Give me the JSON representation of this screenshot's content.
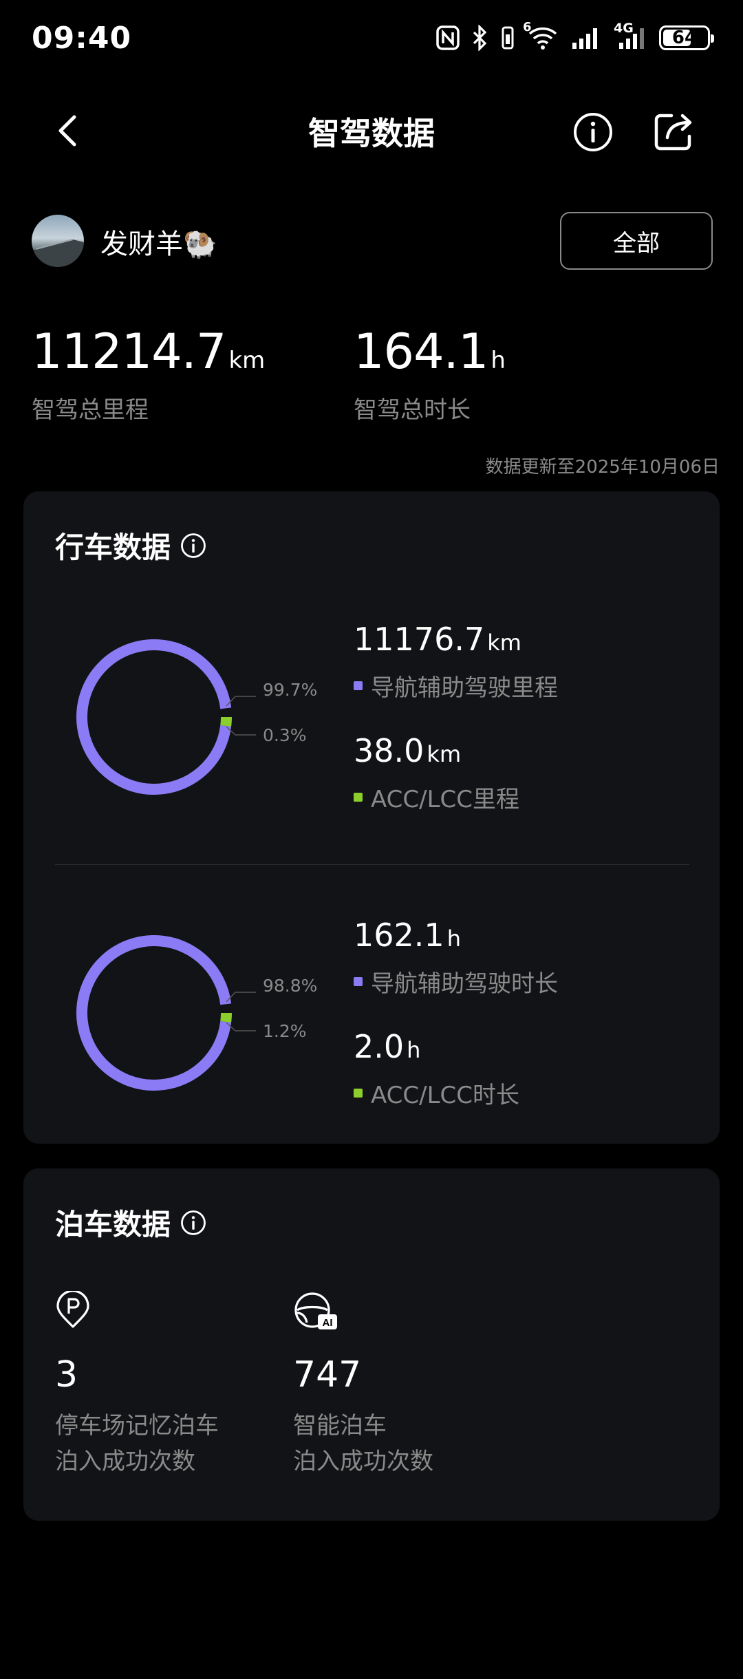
{
  "status_bar": {
    "time": "09:40",
    "battery": "64",
    "battery_level": 0.64,
    "network_label": "4G",
    "wifi_badge": "6",
    "icons": [
      "nfc-icon",
      "bluetooth-icon",
      "wifi-icon",
      "signal-icon",
      "battery-icon"
    ]
  },
  "header": {
    "title": "智驾数据",
    "icons": [
      "back-icon",
      "info-icon",
      "share-icon"
    ]
  },
  "user": {
    "name": "发财羊🐏",
    "filter_label": "全部"
  },
  "totals": {
    "mileage_value": "11214.7",
    "mileage_unit": "km",
    "mileage_label": "智驾总里程",
    "duration_value": "164.1",
    "duration_unit": "h",
    "duration_label": "智驾总时长",
    "update_note": "数据更新至2025年10月06日"
  },
  "driving": {
    "title": "行车数据",
    "mileage": {
      "nav_value": "11176.7",
      "nav_unit": "km",
      "nav_label": "导航辅助驾驶里程",
      "acc_value": "38.0",
      "acc_unit": "km",
      "acc_label": "ACC/LCC里程",
      "nav_pct": "99.7%",
      "acc_pct": "0.3%"
    },
    "duration": {
      "nav_value": "162.1",
      "nav_unit": "h",
      "nav_label": "导航辅助驾驶时长",
      "acc_value": "2.0",
      "acc_unit": "h",
      "acc_label": "ACC/LCC时长",
      "nav_pct": "98.8%",
      "acc_pct": "1.2%"
    }
  },
  "parking": {
    "title": "泊车数据",
    "memory_value": "3",
    "memory_label_1": "停车场记忆泊车",
    "memory_label_2": "泊入成功次数",
    "smart_value": "747",
    "smart_label_1": "智能泊车",
    "smart_label_2": "泊入成功次数",
    "icons": [
      "parking-pin-icon",
      "ai-steering-icon"
    ]
  },
  "colors": {
    "nav": "#8b7cf6",
    "acc": "#8ccf2c",
    "background": "#000000",
    "card": "#121316",
    "muted_text": "#8a8a8a"
  },
  "chart_data": [
    {
      "type": "pie",
      "categories": [
        "导航辅助驾驶里程",
        "ACC/LCC里程"
      ],
      "values": [
        99.7,
        0.3
      ],
      "labels": [
        "99.7%",
        "0.3%"
      ]
    },
    {
      "type": "pie",
      "categories": [
        "导航辅助驾驶时长",
        "ACC/LCC时长"
      ],
      "values": [
        98.8,
        1.2
      ],
      "labels": [
        "98.8%",
        "1.2%"
      ]
    }
  ]
}
